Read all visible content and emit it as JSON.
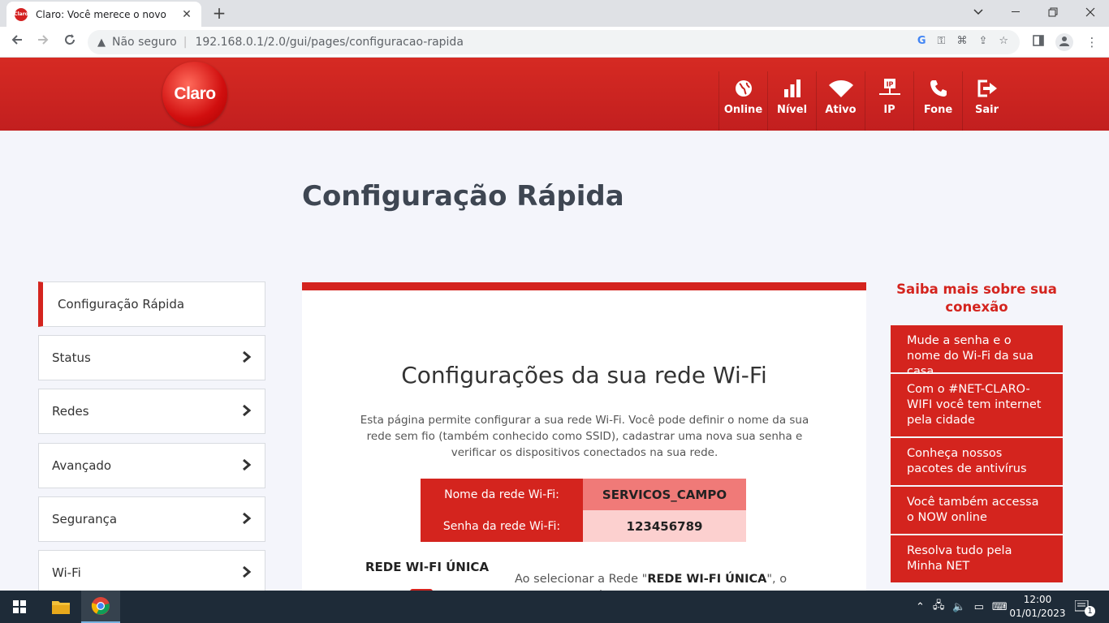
{
  "browser": {
    "tab_title": "Claro: Você merece o novo",
    "tab_favicon_text": "Claro",
    "not_secure_label": "Não seguro",
    "url": "192.168.0.1/2.0/gui/pages/configuracao-rapida"
  },
  "header": {
    "logo_text": "Claro",
    "nav": [
      {
        "label": "Online",
        "icon": "globe-icon"
      },
      {
        "label": "Nível",
        "icon": "signal-bars-icon"
      },
      {
        "label": "Ativo",
        "icon": "wifi-icon"
      },
      {
        "label": "IP",
        "icon": "ip-network-icon"
      },
      {
        "label": "Fone",
        "icon": "phone-icon"
      },
      {
        "label": "Sair",
        "icon": "logout-icon"
      }
    ]
  },
  "page": {
    "title": "Configuração Rápida"
  },
  "menu": [
    {
      "label": "Configuração Rápida",
      "active": true
    },
    {
      "label": "Status"
    },
    {
      "label": "Redes"
    },
    {
      "label": "Avançado"
    },
    {
      "label": "Segurança"
    },
    {
      "label": "Wi-Fi"
    }
  ],
  "card": {
    "heading": "Configurações da sua rede Wi-Fi",
    "description": "Esta página permite configurar a sua rede Wi-Fi. Você pode definir o nome da sua rede sem fio (também conhecido como SSID), cadastrar uma nova sua senha e verificar os dispositivos conectados na sua rede.",
    "wifi_name_label": "Nome da rede Wi-Fi:",
    "wifi_name_value": "SERVICOS_CAMPO",
    "wifi_password_label": "Senha da rede Wi-Fi:",
    "wifi_password_value": "123456789",
    "rede_unica_title": "REDE WI-FI ÚNICA",
    "rede_unica_text_before": "Ao selecionar a Rede \"",
    "rede_unica_text_bold": "REDE WI-FI ÚNICA",
    "rede_unica_text_after": "\", o modem exibirá apenas um nome de rede Wi-Fi que será"
  },
  "sidebar": {
    "title": "Saiba mais sobre sua conexão",
    "links": [
      "Mude a senha e o nome do Wi-Fi da sua casa",
      "Com o #NET-CLARO-WIFI você tem internet pela cidade",
      "Conheça nossos pacotes de antivírus",
      "Você também accessa o NOW online",
      "Resolva tudo pela Minha NET"
    ]
  },
  "taskbar": {
    "time": "12:00",
    "date": "01/01/2023",
    "notification_count": "1"
  },
  "colors": {
    "brand_red": "#d4241e",
    "ssid_bg": "#f07a78",
    "password_bg": "#fcd0cf"
  }
}
